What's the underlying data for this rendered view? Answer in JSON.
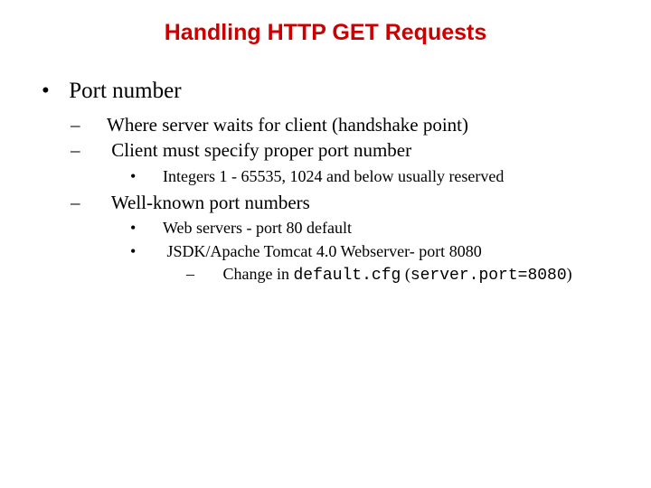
{
  "title": "Handling HTTP GET Requests",
  "bullets": {
    "item1": "Port number",
    "sub1": "Where server waits for client (handshake point)",
    "sub2": "Client must specify proper port number",
    "subsub1": "Integers 1 - 65535, 1024 and below usually reserved",
    "sub3": "Well-known port numbers",
    "subsub2": "Web servers - port 80 default",
    "subsub3": "JSDK/Apache Tomcat 4.0  Webserver- port 8080",
    "subsubsub1_a": "Change in ",
    "subsubsub1_b": "default.cfg",
    "subsubsub1_c": " (",
    "subsubsub1_d": "server.port=8080",
    "subsubsub1_e": ")"
  }
}
